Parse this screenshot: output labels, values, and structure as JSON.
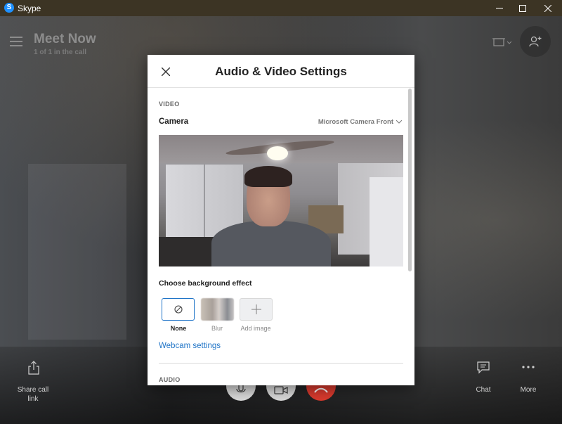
{
  "window": {
    "app_icon_letter": "S",
    "title": "Skype",
    "title_bar_color": "#3c3424"
  },
  "call": {
    "title": "Meet Now",
    "subtitle": "1 of 1 in the call",
    "share_label": "Share call link",
    "chat_label": "Chat",
    "more_label": "More",
    "end_call_color": "#d93a2e"
  },
  "dialog": {
    "title": "Audio & Video Settings",
    "video_section": "VIDEO",
    "camera_label": "Camera",
    "camera_value": "Microsoft Camera Front",
    "background_effect_label": "Choose background effect",
    "effects": [
      {
        "label": "None",
        "selected": true
      },
      {
        "label": "Blur",
        "selected": false
      },
      {
        "label": "Add image",
        "selected": false
      }
    ],
    "webcam_settings_link": "Webcam settings",
    "audio_section": "AUDIO",
    "accent_color": "#1f74c7"
  }
}
